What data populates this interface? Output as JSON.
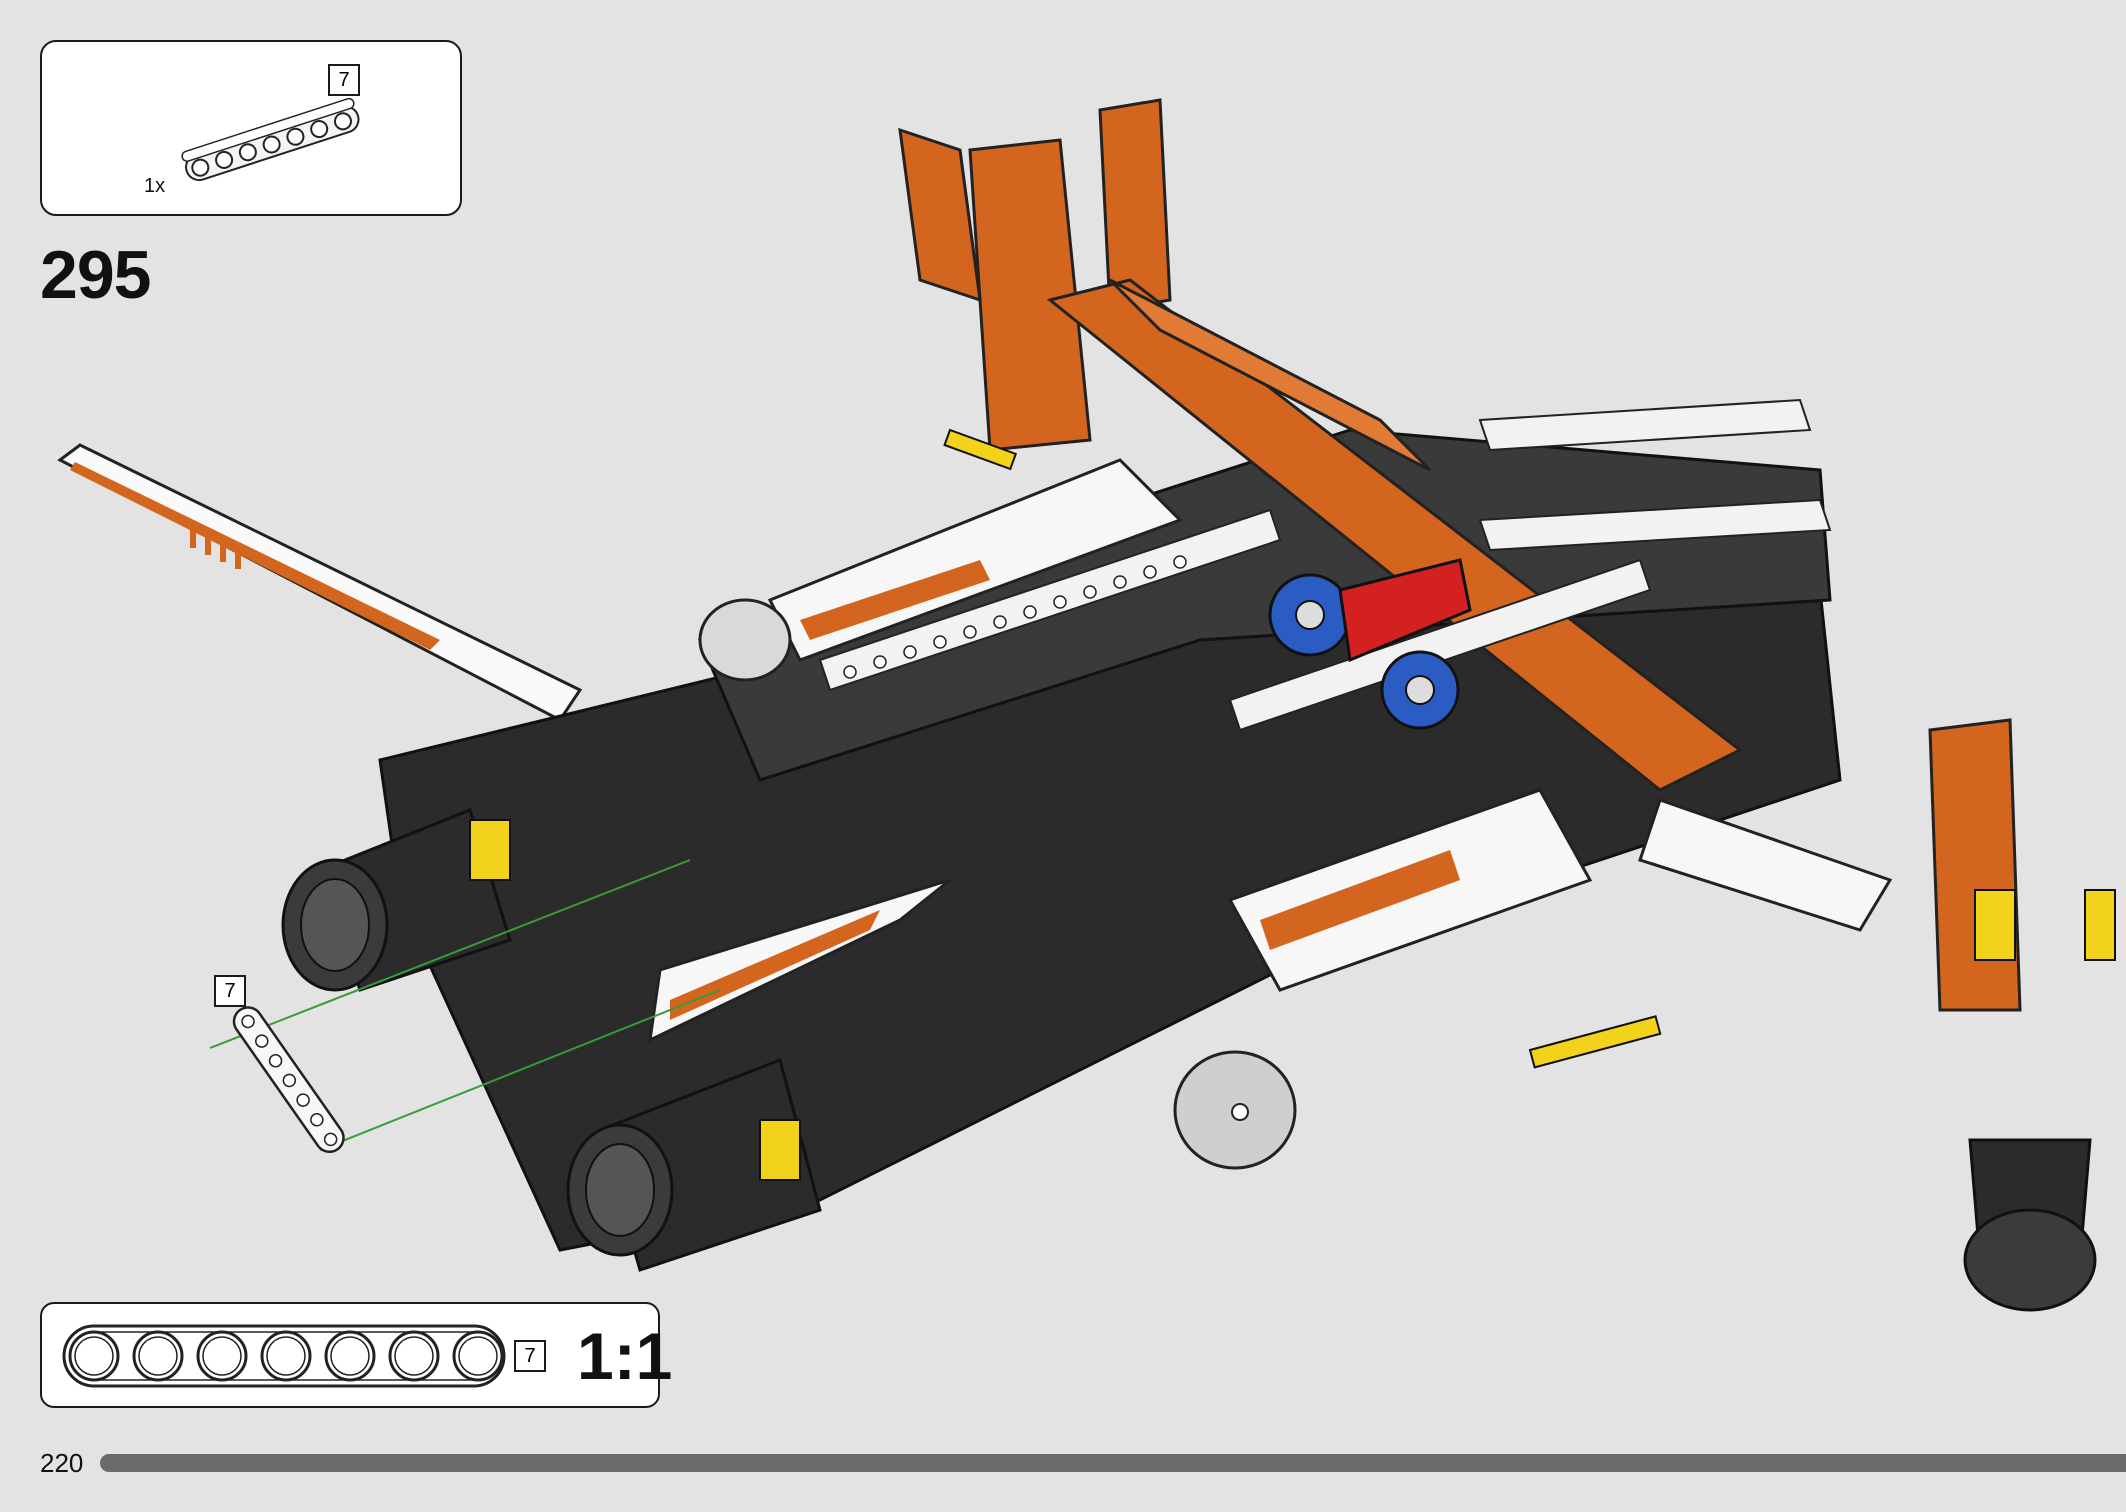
{
  "parts_callout": {
    "length_tag": "7",
    "quantity": "1x"
  },
  "step": {
    "number": "295"
  },
  "assembly_callout": {
    "length_tag": "7"
  },
  "scale_callout": {
    "length_tag": "7",
    "scale": "1:1"
  },
  "footer": {
    "page_number": "220",
    "progress": 1.0
  },
  "colors": {
    "background": "#e3e3e3",
    "orange": "#d4651e",
    "dark": "#2b2b2b",
    "white_part": "#f7f7f7",
    "red": "#d32020",
    "blue": "#2a5cc4",
    "yellow": "#f2d21a",
    "guide_line": "#3a9a3a"
  }
}
